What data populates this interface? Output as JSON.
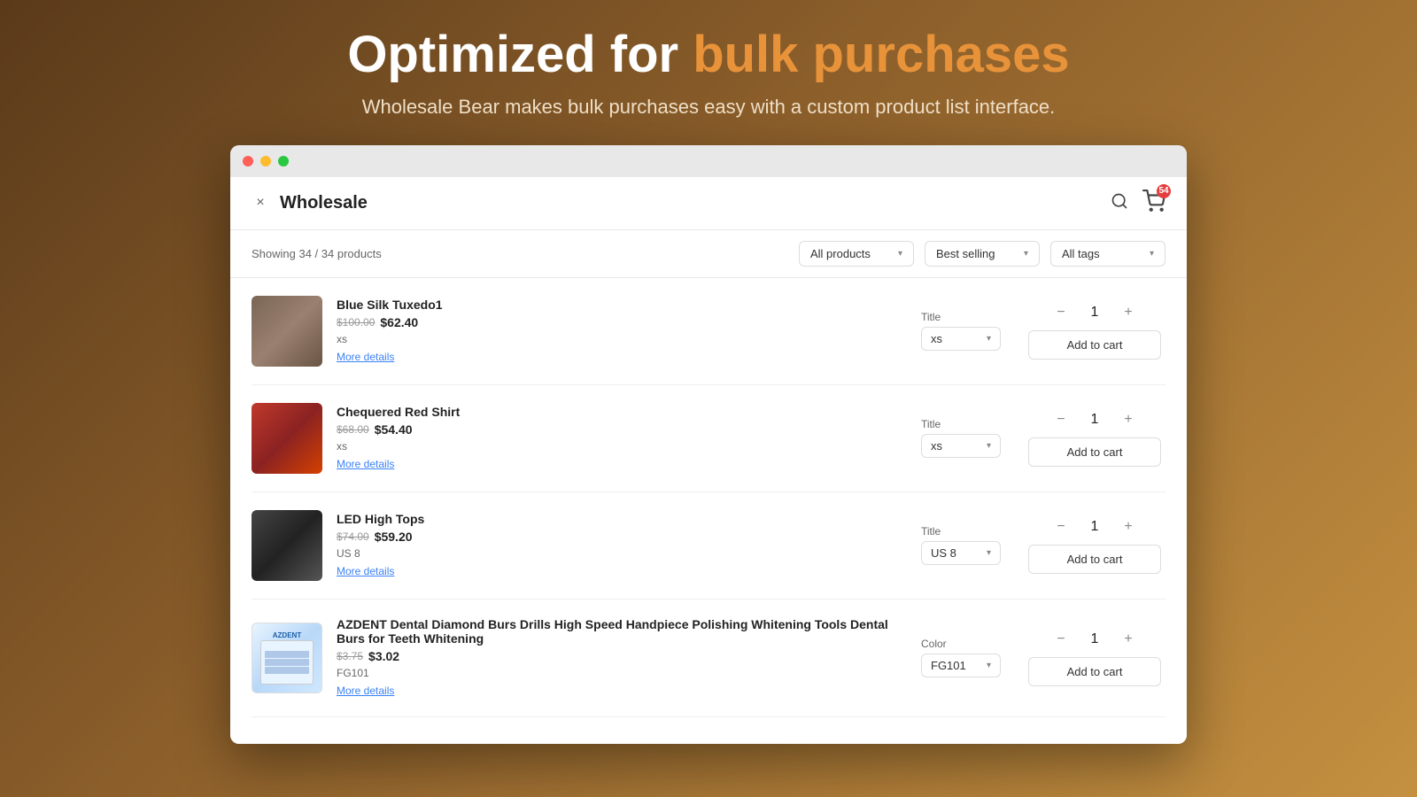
{
  "hero": {
    "title_prefix": "Optimized for ",
    "title_accent": "bulk purchases",
    "subtitle": "Wholesale Bear makes bulk purchases easy with a custom product list interface."
  },
  "browser": {
    "dots": [
      "red",
      "yellow",
      "green"
    ]
  },
  "header": {
    "close_label": "×",
    "title": "Wholesale",
    "search_icon": "🔍",
    "cart_icon": "🛒",
    "cart_count": "54"
  },
  "filter_bar": {
    "showing_text": "Showing 34 / 34 products",
    "filters": [
      {
        "label": "All products",
        "id": "all-products-filter"
      },
      {
        "label": "Best selling",
        "id": "best-selling-filter"
      },
      {
        "label": "All tags",
        "id": "all-tags-filter"
      }
    ]
  },
  "products": [
    {
      "id": "product-1",
      "name": "Blue Silk Tuxedo1",
      "price_original": "$100.00",
      "price_sale": "$62.40",
      "variant_text": "xs",
      "more_details": "More details",
      "variant_label": "Title",
      "variant_value": "xs",
      "qty": "1",
      "add_to_cart": "Add to cart",
      "img_class": "img-tuxedo"
    },
    {
      "id": "product-2",
      "name": "Chequered Red Shirt",
      "price_original": "$68.00",
      "price_sale": "$54.40",
      "variant_text": "xs",
      "more_details": "More details",
      "variant_label": "Title",
      "variant_value": "xs",
      "qty": "1",
      "add_to_cart": "Add to cart",
      "img_class": "img-shirt"
    },
    {
      "id": "product-3",
      "name": "LED High Tops",
      "price_original": "$74.00",
      "price_sale": "$59.20",
      "variant_text": "US 8",
      "more_details": "More details",
      "variant_label": "Title",
      "variant_value": "US 8",
      "qty": "1",
      "add_to_cart": "Add to cart",
      "img_class": "img-shoes"
    },
    {
      "id": "product-4",
      "name": "AZDENT Dental Diamond Burs Drills High Speed Handpiece Polishing Whitening Tools Dental Burs for Teeth Whitening",
      "price_original": "$3.75",
      "price_sale": "$3.02",
      "variant_text": "FG101",
      "more_details": "More details",
      "variant_label": "Color",
      "variant_value": "FG101",
      "qty": "1",
      "add_to_cart": "Add to cart",
      "img_class": "img-dental"
    }
  ]
}
